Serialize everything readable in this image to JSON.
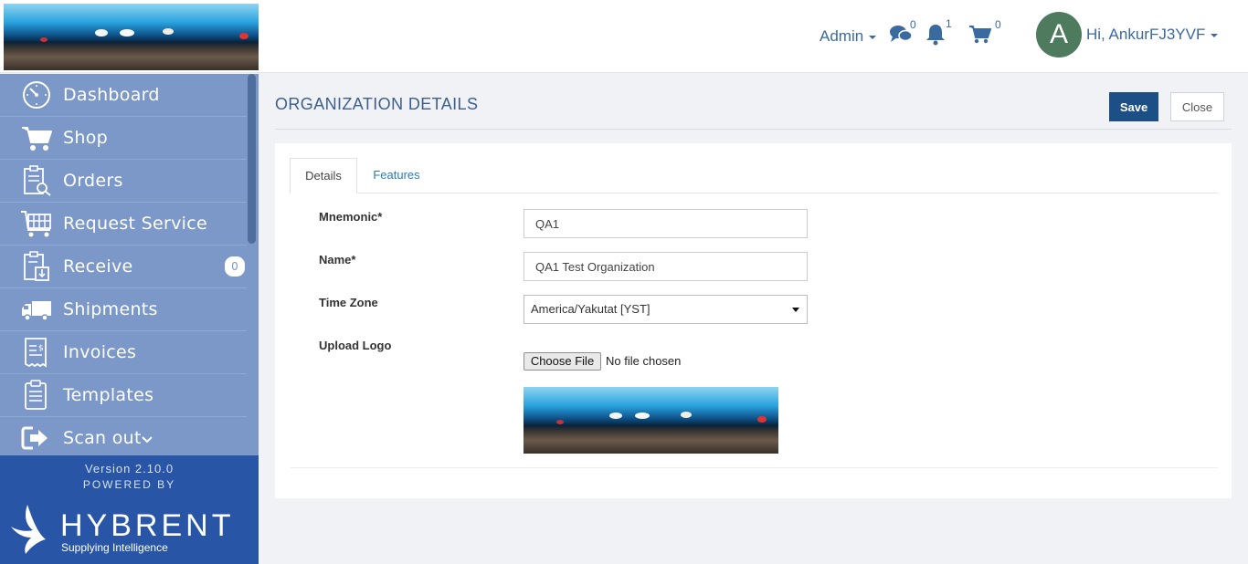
{
  "header": {
    "role_menu_label": "Admin",
    "messages_count": "0",
    "notifications_count": "1",
    "cart_count": "0",
    "avatar_initial": "A",
    "greeting": "Hi, AnkurFJ3YVF"
  },
  "sidebar": {
    "items": [
      {
        "label": "Dashboard",
        "icon": "dashboard-icon"
      },
      {
        "label": "Shop",
        "icon": "cart-icon"
      },
      {
        "label": "Orders",
        "icon": "orders-icon"
      },
      {
        "label": "Request Service",
        "icon": "request-service-icon"
      },
      {
        "label": "Receive",
        "icon": "receive-icon",
        "badge": "0"
      },
      {
        "label": "Shipments",
        "icon": "truck-icon"
      },
      {
        "label": "Invoices",
        "icon": "invoice-icon"
      },
      {
        "label": "Templates",
        "icon": "templates-icon"
      },
      {
        "label": "Scan out",
        "icon": "sign-out-icon"
      }
    ],
    "version": "Version 2.10.0",
    "powered_by": "POWERED BY",
    "brand_name": "HYBRENT",
    "brand_tagline": "Supplying Intelligence"
  },
  "page": {
    "title": "ORGANIZATION DETAILS",
    "save_label": "Save",
    "close_label": "Close"
  },
  "tabs": [
    {
      "label": "Details",
      "active": true
    },
    {
      "label": "Features",
      "active": false
    }
  ],
  "form": {
    "mnemonic_label": "Mnemonic*",
    "mnemonic_value": "QA1",
    "name_label": "Name*",
    "name_value": "QA1 Test Organization",
    "timezone_label": "Time Zone",
    "timezone_value": "America/Yakutat [YST]",
    "upload_label": "Upload Logo",
    "file_button": "Choose File",
    "file_status": "No file chosen"
  },
  "colors": {
    "sidebar_bg": "#7b98c8",
    "sidebar_footer": "#2855a6",
    "primary_button": "#1c4f86",
    "link": "#2a7bbd",
    "avatar": "#4e7a5e"
  }
}
